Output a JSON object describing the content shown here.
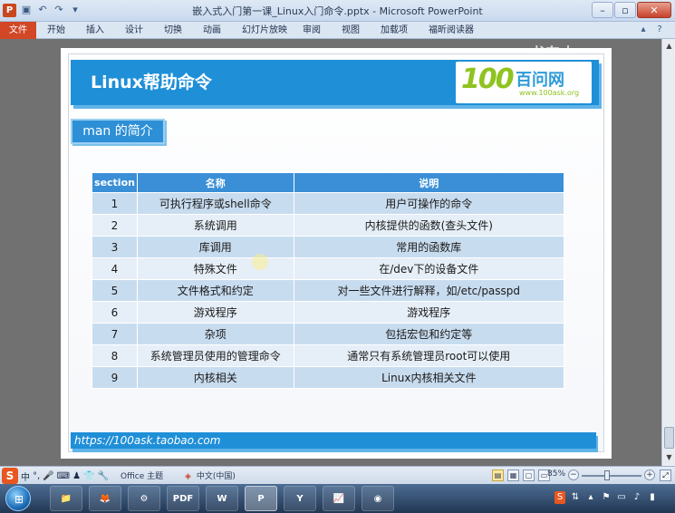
{
  "window": {
    "title": "嵌入式入门第一课_Linux入门命令.pptx - Microsoft PowerPoint",
    "app_icon": "P",
    "controls": {
      "minimize": "–",
      "restore": "▫",
      "close": "✕"
    }
  },
  "quick_access": [
    "save-icon",
    "undo-icon",
    "redo-icon",
    "customize-icon"
  ],
  "ribbon": {
    "file_tab": "文件",
    "tabs": [
      "开始",
      "插入",
      "设计",
      "切换",
      "动画",
      "幻灯片放映",
      "审阅",
      "视图",
      "加载项",
      "福昕阅读器"
    ]
  },
  "watermark": "书东山",
  "slide": {
    "title": "Linux帮助命令",
    "logo": {
      "number": "100",
      "name": "百问网",
      "url": "www.100ask.org"
    },
    "subtitle": "man 的简介",
    "table": {
      "headers": [
        "section",
        "名称",
        "说明"
      ],
      "rows": [
        [
          "1",
          "可执行程序或shell命令",
          "用户可操作的命令"
        ],
        [
          "2",
          "系统调用",
          "内核提供的函数(查头文件)"
        ],
        [
          "3",
          "库调用",
          "常用的函数库"
        ],
        [
          "4",
          "特殊文件",
          "在/dev下的设备文件"
        ],
        [
          "5",
          "文件格式和约定",
          "对一些文件进行解释，如/etc/passpd"
        ],
        [
          "6",
          "游戏程序",
          "游戏程序"
        ],
        [
          "7",
          "杂项",
          "包括宏包和约定等"
        ],
        [
          "8",
          "系统管理员使用的管理命令",
          "通常只有系统管理员root可以使用"
        ],
        [
          "9",
          "内核相关",
          "Linux内核相关文件"
        ]
      ]
    },
    "footer_url": "https://100ask.taobao.com"
  },
  "statusbar": {
    "ime": {
      "logo": "S",
      "mode": "中",
      "punct": "°,"
    },
    "theme": "Office 主题",
    "language": "中文(中国)",
    "zoom": "85%",
    "zoom_value": 0.85
  },
  "taskbar": {
    "start_label": "⊞",
    "apps": [
      {
        "name": "file-explorer",
        "label": "📁"
      },
      {
        "name": "firefox",
        "label": "🦊"
      },
      {
        "name": "app-yellow",
        "label": "⚙"
      },
      {
        "name": "pdf-reader",
        "label": "PDF"
      },
      {
        "name": "word",
        "label": "W"
      },
      {
        "name": "powerpoint",
        "label": "P"
      },
      {
        "name": "app-y",
        "label": "Y"
      },
      {
        "name": "app-chart",
        "label": "📈"
      },
      {
        "name": "app-red",
        "label": "◉"
      }
    ]
  }
}
